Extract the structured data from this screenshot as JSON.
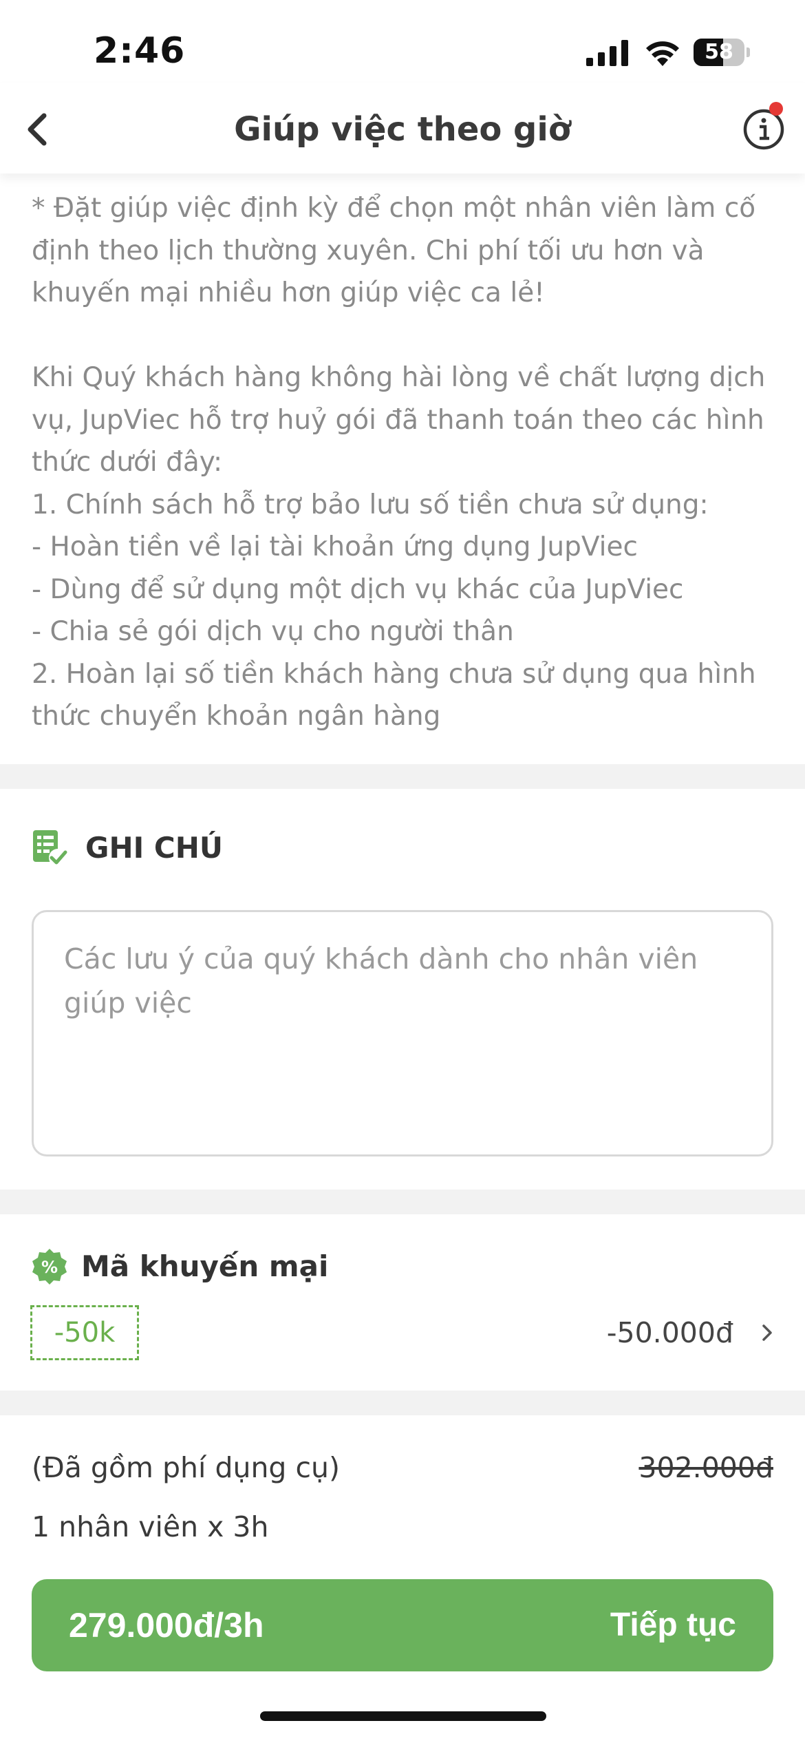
{
  "status_bar": {
    "time": "2:46",
    "battery": "58",
    "battery_level": 0.58
  },
  "header": {
    "title": "Giúp việc theo giờ",
    "back_icon": "chevron-left-icon",
    "info_icon": "info-icon"
  },
  "policy": {
    "text": "* Đặt giúp việc định kỳ để chọn một nhân viên làm cố định theo lịch thường xuyên. Chi phí tối ưu hơn và khuyến mại nhiều hơn giúp việc ca lẻ!\n\nKhi Quý khách hàng không hài lòng về chất lượng dịch vụ, JupViec hỗ trợ huỷ gói đã thanh toán theo các hình thức dưới đây:\n1. Chính sách hỗ trợ bảo lưu số tiền chưa sử dụng:\n- Hoàn tiền về lại tài khoản ứng dụng JupViec\n- Dùng để sử dụng một dịch vụ khác của JupViec\n- Chia sẻ gói dịch vụ cho người thân\n2. Hoàn lại số tiền khách hàng chưa sử dụng qua hình thức chuyển khoản ngân hàng"
  },
  "note": {
    "title": "GHI CHÚ",
    "icon": "note-check-icon",
    "value": "",
    "placeholder": "Các lưu ý của quý khách dành cho nhân viên giúp việc"
  },
  "promo": {
    "title": "Mã khuyến mại",
    "icon": "percent-badge-icon",
    "code": "-50k",
    "discount": "-50.000đ"
  },
  "summary": {
    "fee_note": "(Đã gồm phí dụng cụ)",
    "original_price": "302.000đ",
    "workers": "1 nhân viên x 3h"
  },
  "cta": {
    "price": "279.000đ/3h",
    "label": "Tiếp tục"
  },
  "colors": {
    "accent_green": "#6ab25c",
    "promo_green": "#6ab04c",
    "notification_red": "#e53935"
  }
}
